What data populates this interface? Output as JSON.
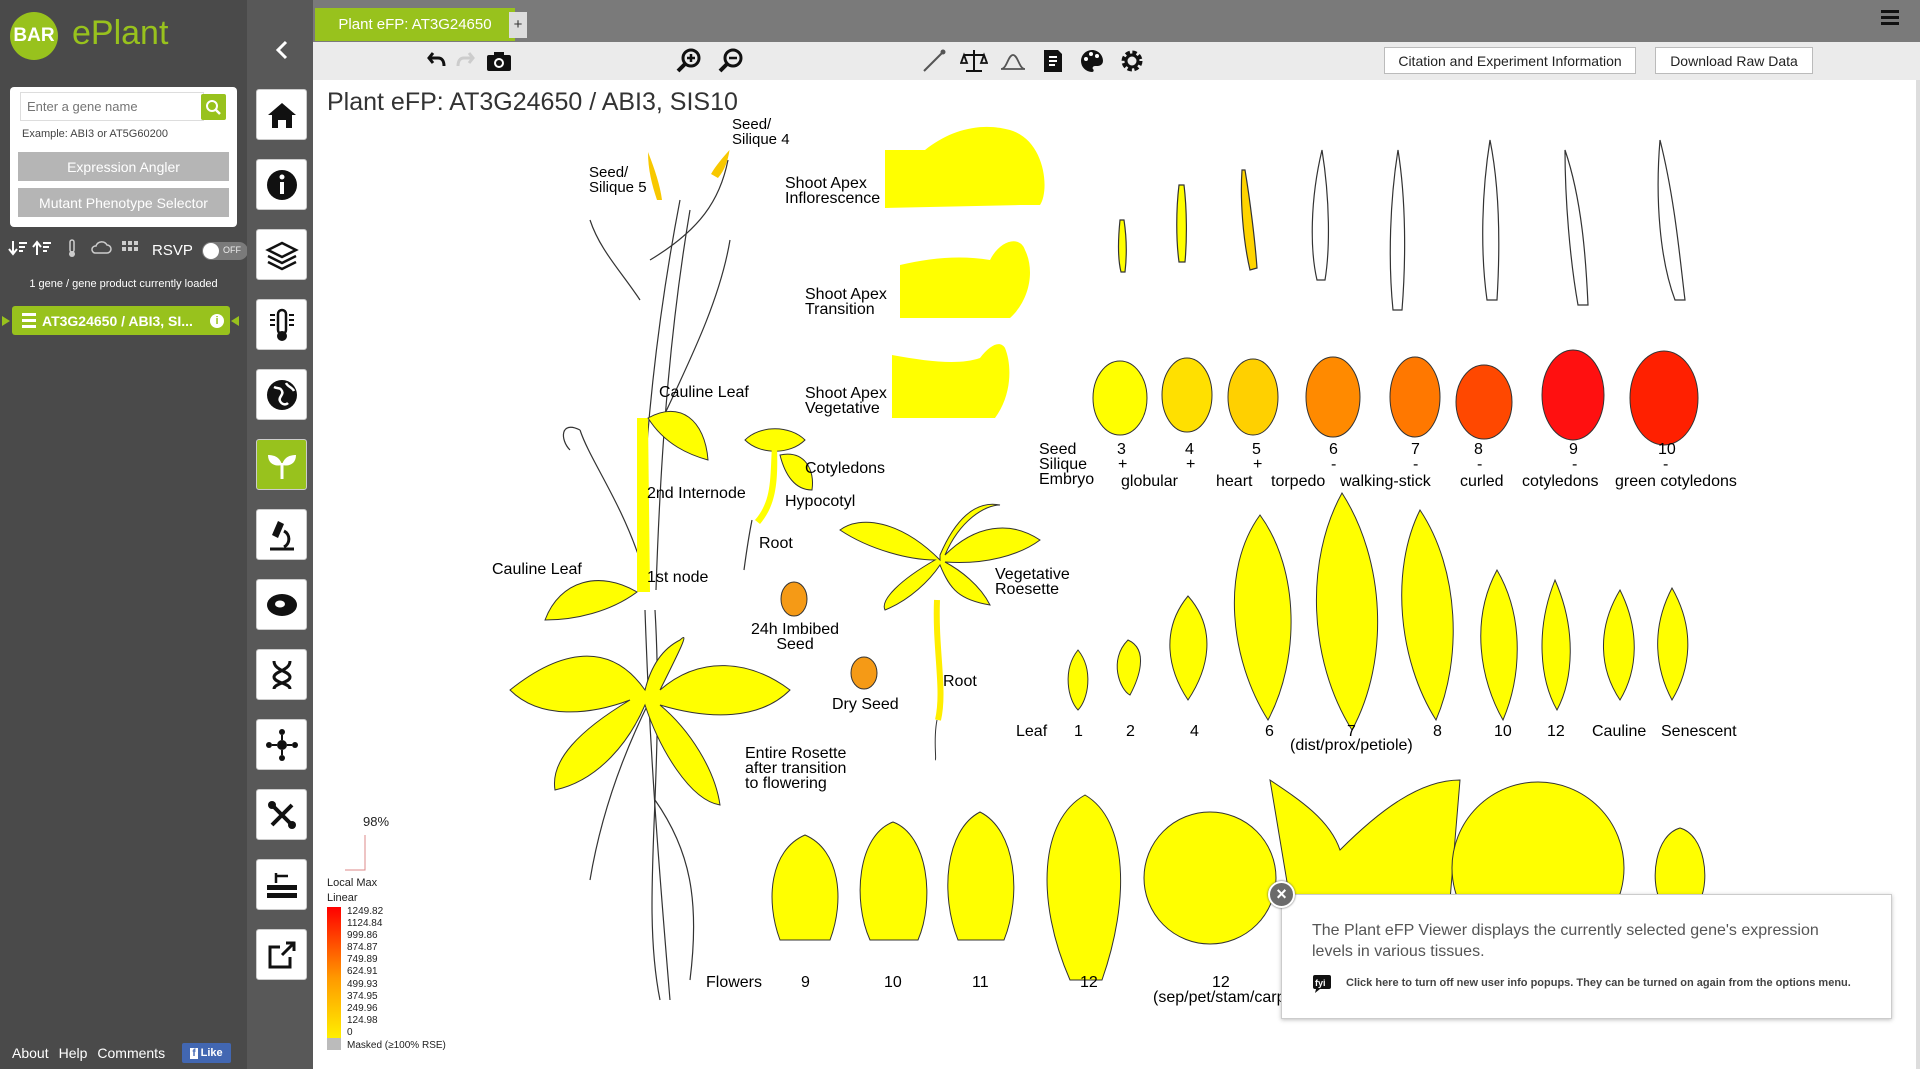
{
  "app": {
    "logo_badge": "BAR",
    "logo_text": "ePlant"
  },
  "search": {
    "placeholder": "Enter a gene name",
    "example": "Example: ABI3 or AT5G60200",
    "expression_angler": "Expression Angler",
    "mutant_selector": "Mutant Phenotype Selector"
  },
  "toolrow": {
    "rsvp": "RSVP",
    "rsvp_state": "OFF"
  },
  "genes": {
    "loaded_count": "1 gene / gene product currently loaded",
    "active_gene": "AT3G24650 / ABI3, SI..."
  },
  "footer": {
    "about": "About",
    "help": "Help",
    "comments": "Comments",
    "like": "Like"
  },
  "tabs": [
    {
      "label": "Plant eFP: AT3G24650"
    }
  ],
  "tab_add": "+",
  "toolbar": {
    "citation": "Citation and Experiment Information",
    "download": "Download Raw Data"
  },
  "view": {
    "title": "Plant eFP: AT3G24650 / ABI3, SIS10"
  },
  "labels": {
    "seed_silique_4": [
      "Seed/",
      "Silique 4"
    ],
    "seed_silique_5": [
      "Seed/",
      "Silique 5"
    ],
    "shoot_apex_infl": [
      "Shoot Apex",
      "Inflorescence"
    ],
    "shoot_apex_trans": [
      "Shoot Apex",
      "Transition"
    ],
    "shoot_apex_veg": [
      "Shoot Apex",
      "Vegetative"
    ],
    "cauline_leaf_top": "Cauline Leaf",
    "second_internode": "2nd Internode",
    "cotyledons": "Cotyledons",
    "hypocotyl": "Hypocotyl",
    "root_seedling": "Root",
    "cauline_leaf_left": "Cauline Leaf",
    "first_node": "1st node",
    "imbibed_seed": [
      "24h Imbibed",
      "Seed"
    ],
    "dry_seed": "Dry Seed",
    "veg_rosette": [
      "Vegetative",
      "Roesette"
    ],
    "root_rosette": "Root",
    "entire_rosette": [
      "Entire Rosette",
      "after transition",
      "to flowering"
    ]
  },
  "seed_row": {
    "row_labels": [
      "Seed",
      "Silique",
      "Embryo"
    ],
    "numbers": [
      "3",
      "4",
      "5",
      "6",
      "7",
      "8",
      "9",
      "10"
    ],
    "marks": [
      "+",
      "+",
      "+",
      "-",
      "-",
      "-",
      "-",
      "-"
    ],
    "stages": [
      "globular",
      "heart",
      "torpedo",
      "walking-stick",
      "curled",
      "cotyledons",
      "green cotyledons"
    ]
  },
  "leaf_row": {
    "row_label": "Leaf",
    "labels": [
      "1",
      "2",
      "4",
      "6",
      "7",
      "8",
      "10",
      "12",
      "Cauline",
      "Senescent"
    ],
    "sub_label": "(dist/prox/petiole)"
  },
  "flower_row": {
    "row_label": "Flowers",
    "labels": [
      "9",
      "10",
      "11",
      "12",
      "12"
    ],
    "sub_label": "(sep/pet/stam/carp"
  },
  "legend": {
    "percent": "98%",
    "title1": "Local Max",
    "title2": "Linear",
    "values": [
      "1249.82",
      "1124.84",
      "999.86",
      "874.87",
      "749.89",
      "624.91",
      "499.93",
      "374.95",
      "249.96",
      "124.98",
      "0"
    ],
    "masked": "Masked (≥100% RSE)"
  },
  "popup": {
    "message": "The Plant eFP Viewer displays the currently selected gene's expression levels in various tissues.",
    "note": "Click here to turn off new user info popups. They can be turned on again from the options menu."
  },
  "colors": {
    "accent": "#98c21d",
    "low": "#ffff00",
    "mid": "#ff9900",
    "high": "#ff0000",
    "sidebar": "#4a4a4a"
  }
}
